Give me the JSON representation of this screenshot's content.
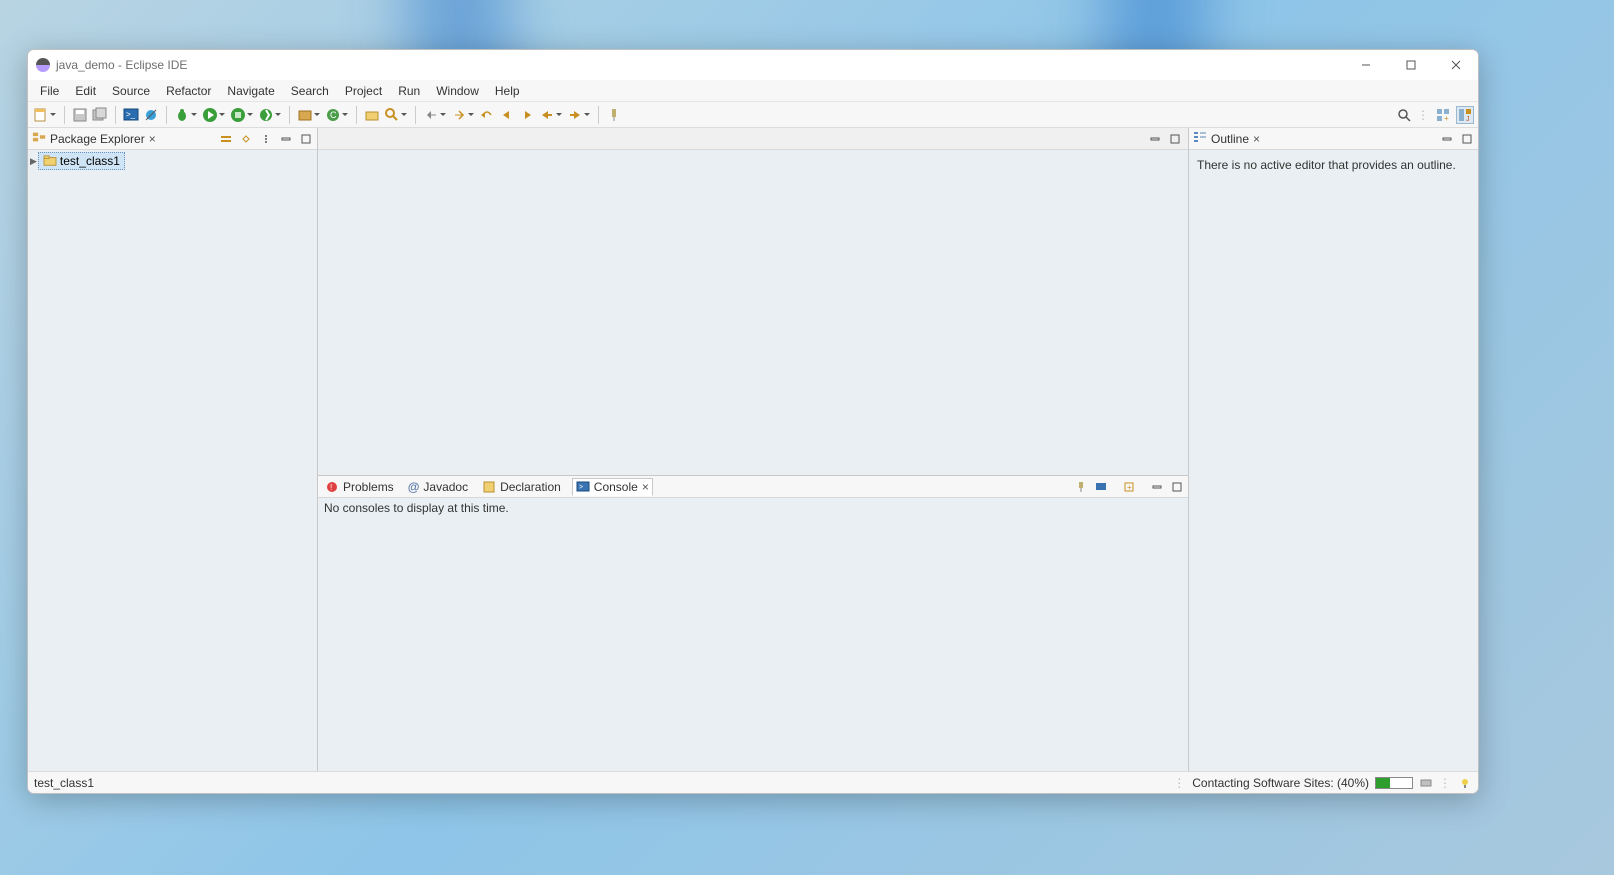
{
  "window": {
    "title": "java_demo - Eclipse IDE"
  },
  "menu": [
    "File",
    "Edit",
    "Source",
    "Refactor",
    "Navigate",
    "Search",
    "Project",
    "Run",
    "Window",
    "Help"
  ],
  "packageExplorer": {
    "title": "Package Explorer",
    "tree": {
      "item0": "test_class1"
    }
  },
  "outline": {
    "title": "Outline",
    "message": "There is no active editor that provides an outline."
  },
  "bottomTabs": {
    "problems": "Problems",
    "javadoc": "Javadoc",
    "declaration": "Declaration",
    "console": "Console",
    "consoleMessage": "No consoles to display at this time."
  },
  "status": {
    "left": "test_class1",
    "right": "Contacting Software Sites: (40%)"
  }
}
